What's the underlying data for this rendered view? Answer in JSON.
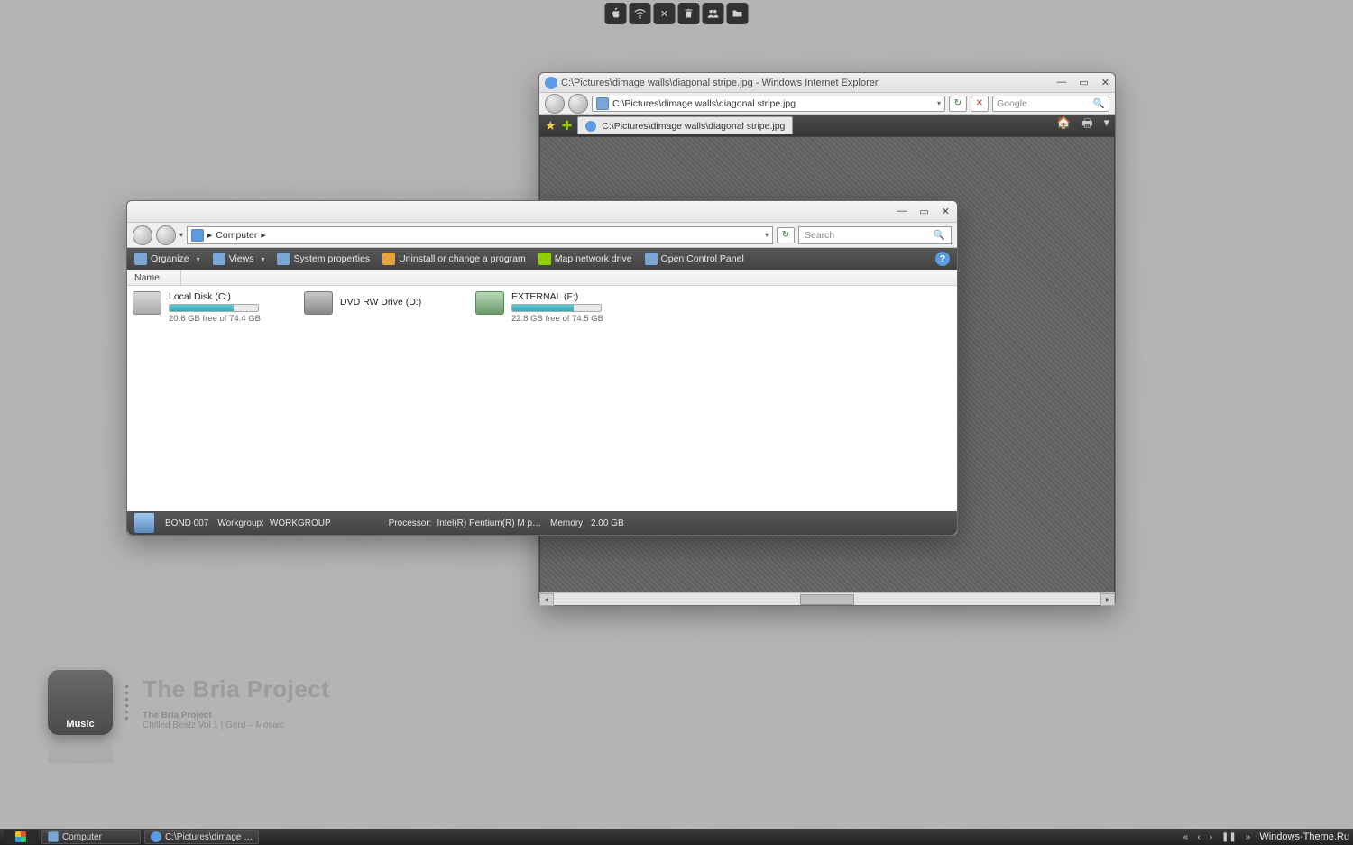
{
  "dock": {
    "icons": [
      "apple",
      "wifi",
      "tools",
      "trash",
      "users",
      "folder"
    ]
  },
  "ie": {
    "title": "C:\\Pictures\\dimage walls\\diagonal stripe.jpg - Windows Internet Explorer",
    "address": "C:\\Pictures\\dimage walls\\diagonal stripe.jpg",
    "search_placeholder": "Google",
    "tab_label": "C:\\Pictures\\dimage walls\\diagonal stripe.jpg"
  },
  "explorer": {
    "breadcrumb_icon": "Computer",
    "breadcrumb_sep": "▸",
    "search_placeholder": "Search",
    "toolbar": {
      "organize": "Organize",
      "views": "Views",
      "sysprops": "System properties",
      "uninstall": "Uninstall or change a program",
      "mapdrive": "Map network drive",
      "controlpanel": "Open Control Panel"
    },
    "columns": {
      "name": "Name"
    },
    "drives": {
      "c": {
        "label": "Local Disk (C:)",
        "free": "20.6 GB free of 74.4 GB",
        "fill_pct": 72
      },
      "d": {
        "label": "DVD RW Drive (D:)"
      },
      "f": {
        "label": "EXTERNAL (F:)",
        "free": "22.8 GB free of 74.5 GB",
        "fill_pct": 69
      }
    },
    "status": {
      "host": "BOND 007",
      "workgroup_label": "Workgroup:",
      "workgroup": "WORKGROUP",
      "processor_label": "Processor:",
      "processor": "Intel(R) Pentium(R) M p…",
      "memory_label": "Memory:",
      "memory": "2.00 GB"
    }
  },
  "music": {
    "tile": "Music",
    "title": "The Bria Project",
    "line1": "The Bria Project",
    "line2": "Chilled Beatz Vol 1  |  Gerd – Mosaic"
  },
  "taskbar": {
    "btn1": "Computer",
    "btn2": "C:\\Pictures\\dimage …"
  },
  "watermark": "Windows-Theme.Ru"
}
